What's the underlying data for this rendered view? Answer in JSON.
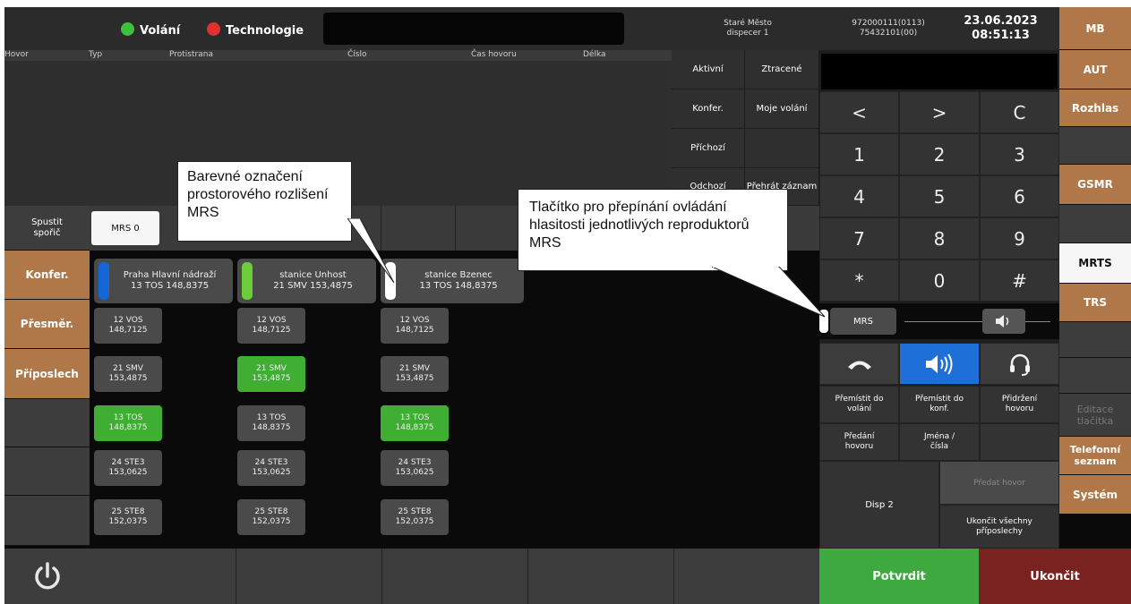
{
  "header": {
    "volani_label": "Volání",
    "technologie_label": "Technologie",
    "location": "Staré Město",
    "dispecer": "dispecer 1",
    "number1": "972000111(0113)",
    "number2": "75432101(00)",
    "date": "23.06.2023",
    "time": "08:51:13",
    "status_colors": {
      "volani": "#3fbf3f",
      "technologie": "#e03030"
    }
  },
  "call_table": {
    "columns": [
      "Hovor",
      "Typ",
      "Protistrana",
      "Číslo",
      "Čas hovoru",
      "Délka"
    ]
  },
  "filters": [
    [
      "Aktivní",
      "Ztracené"
    ],
    [
      "Konfer.",
      "Moje volání"
    ],
    [
      "Příchozí",
      ""
    ],
    [
      "Odchozí",
      "Přehrát záznam"
    ]
  ],
  "keypad": {
    "keys": [
      "<",
      ">",
      "C",
      "1",
      "2",
      "3",
      "4",
      "5",
      "6",
      "7",
      "8",
      "9",
      "*",
      "0",
      "#"
    ],
    "mrs_label": "MRS",
    "actions": [
      "Přemístit do volání",
      "Přemístit do konf.",
      "Přidržení hovoru",
      "Předání hovoru",
      "Jména / čísla",
      ""
    ],
    "disp_label": "Disp 2",
    "predat_label": "Předat hovor",
    "ukoncit_vse_label": "Ukončit všechny příposlechy",
    "confirm_label": "Potvrdit",
    "end_label": "Ukončit"
  },
  "right_menu": [
    "MB",
    "AUT",
    "Rozhlas",
    "",
    "GSMR",
    "",
    "MRTS",
    "TRS",
    "",
    "",
    "Editace tlačítka",
    "Telefonní seznam",
    "Systém"
  ],
  "left_menu": {
    "spoŕic_label": "Spustit spořič",
    "konfer": "Konfer.",
    "presmer": "Přesměr.",
    "priposlech": "Příposlech"
  },
  "mrs_tab": "MRS 0",
  "stations": [
    {
      "name": "Praha Hlavní nádraží",
      "sub": "13 TOS 148,8375",
      "marker": "#1566d6"
    },
    {
      "name": "stanice Unhost",
      "sub": "21 SMV 153,4875",
      "marker": "#6ccc3a"
    },
    {
      "name": "stanice Bzenec",
      "sub": "13 TOS 148,8375",
      "marker": "#ffffff"
    }
  ],
  "channel_columns": [
    [
      {
        "l1": "12 VOS",
        "l2": "148,7125",
        "on": false
      },
      {
        "l1": "21 SMV",
        "l2": "153,4875",
        "on": false
      },
      {
        "l1": "13 TOS",
        "l2": "148,8375",
        "on": true
      },
      {
        "l1": "24 STE3",
        "l2": "153,0625",
        "on": false
      },
      {
        "l1": "25 STE8",
        "l2": "152,0375",
        "on": false
      }
    ],
    [
      {
        "l1": "12 VOS",
        "l2": "148,7125",
        "on": false
      },
      {
        "l1": "21 SMV",
        "l2": "153,4875",
        "on": true
      },
      {
        "l1": "13 TOS",
        "l2": "148,8375",
        "on": false
      },
      {
        "l1": "24 STE3",
        "l2": "153,0625",
        "on": false
      },
      {
        "l1": "25 STE8",
        "l2": "152,0375",
        "on": false
      }
    ],
    [
      {
        "l1": "12 VOS",
        "l2": "148,7125",
        "on": false
      },
      {
        "l1": "21 SMV",
        "l2": "153,4875",
        "on": false
      },
      {
        "l1": "13 TOS",
        "l2": "148,8375",
        "on": true
      },
      {
        "l1": "24 STE3",
        "l2": "153,0625",
        "on": false
      },
      {
        "l1": "25 STE8",
        "l2": "152,0375",
        "on": false
      }
    ]
  ],
  "callouts": {
    "left": "Barevné   označení prostorového rozlišení MRS",
    "right": "Tlačítko pro přepínání ovládání hlasitosti jednotlivých reproduktorů MRS"
  }
}
